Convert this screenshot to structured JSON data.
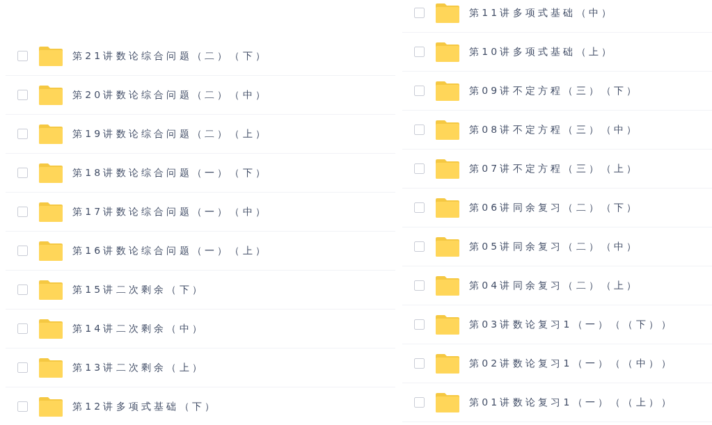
{
  "columns": [
    {
      "items": [
        {
          "name": "第21讲数论综合问题（二）（下）",
          "checked": false
        },
        {
          "name": "第20讲数论综合问题（二）（中）",
          "checked": false
        },
        {
          "name": "第19讲数论综合问题（二）（上）",
          "checked": false
        },
        {
          "name": "第18讲数论综合问题（一）（下）",
          "checked": false
        },
        {
          "name": "第17讲数论综合问题（一）（中）",
          "checked": false
        },
        {
          "name": "第16讲数论综合问题（一）（上）",
          "checked": false
        },
        {
          "name": "第15讲二次剩余（下）",
          "checked": false
        },
        {
          "name": "第14讲二次剩余（中）",
          "checked": false
        },
        {
          "name": "第13讲二次剩余（上）",
          "checked": false
        },
        {
          "name": "第12讲多项式基础（下）",
          "checked": false
        }
      ]
    },
    {
      "items": [
        {
          "name": "第11讲多项式基础（中）",
          "checked": false
        },
        {
          "name": "第10讲多项式基础（上）",
          "checked": false
        },
        {
          "name": "第09讲不定方程（三）（下）",
          "checked": false
        },
        {
          "name": "第08讲不定方程（三）（中）",
          "checked": false
        },
        {
          "name": "第07讲不定方程（三）（上）",
          "checked": false
        },
        {
          "name": "第06讲同余复习（二）（下）",
          "checked": false
        },
        {
          "name": "第05讲同余复习（二）（中）",
          "checked": false
        },
        {
          "name": "第04讲同余复习（二）（上）",
          "checked": false
        },
        {
          "name": "第03讲数论复习1（一）（（下））",
          "checked": false
        },
        {
          "name": "第02讲数论复习1（一）（（中））",
          "checked": false
        },
        {
          "name": "第01讲数论复习1（一）（（上））",
          "checked": false
        }
      ]
    }
  ]
}
